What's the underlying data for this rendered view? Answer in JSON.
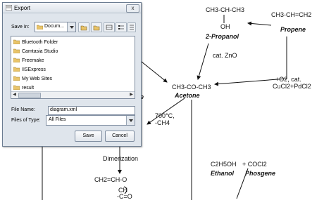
{
  "diagram": {
    "top_left_formula": "CH3-CH-CH3",
    "oh": "OH",
    "propanol_name": "2-Propanol",
    "propene_formula": "CH3-CH=CH2",
    "propene_name": "Propene",
    "catalyst_zno": "cat. ZnO",
    "oxidation_line1": "+O2, cat.",
    "oxidation_line2": "CuCl2+PdCl2",
    "acetone_formula": "CH3-CO-CH3",
    "acetone_name": "Acetone",
    "heat_line1": "700°C,",
    "heat_line2": "-CH4",
    "dimerization": "Dimerization",
    "ketene_formula": "CH2=CH-O",
    "ketene_sub1": "CH",
    "ketene_sub2": "-C=O",
    "ethanol_formula": "C2H5OH",
    "ethanol_name": "Ethanol",
    "phosgene_formula": "+ COCl2",
    "phosgene_name": "Phosgene",
    "partial_e": "e"
  },
  "dialog": {
    "title": "Export",
    "close_label": "x",
    "save_in_label": "Save In:",
    "save_in_value": "Docum...",
    "folders": [
      "Bluetooth Folder",
      "Camtasia Studio",
      "Freemake",
      "IISExpress",
      "My Web Sites",
      "result"
    ],
    "file_name_label": "File Name:",
    "file_name_value": "diagram.xml",
    "file_type_label": "Files of Type:",
    "file_type_value": "All Files",
    "save_button": "Save",
    "cancel_button": "Cancel"
  },
  "colors": {
    "folder": "#e9c46a",
    "dialog_bg": "#dfe5ec",
    "line": "#111111"
  }
}
